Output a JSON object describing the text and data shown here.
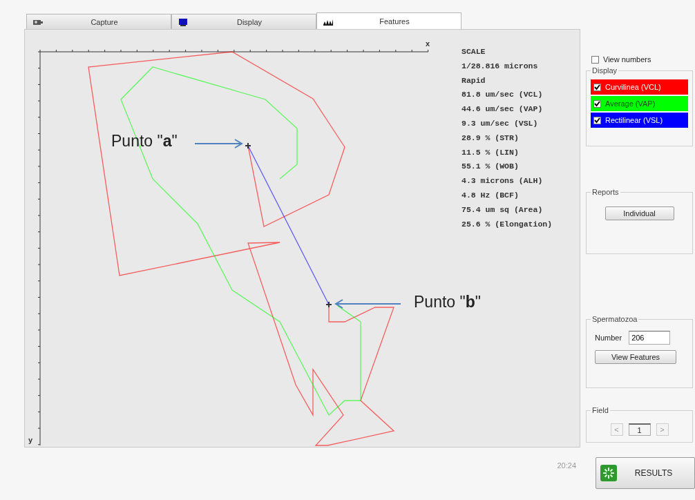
{
  "tabs": [
    {
      "label": "Capture",
      "kind": "camera",
      "selected": false
    },
    {
      "label": "Display",
      "kind": "monitor",
      "selected": false
    },
    {
      "label": "Features",
      "kind": "tracks",
      "selected": true
    }
  ],
  "plot": {
    "x_label": "x",
    "y_label": "y",
    "annotations": [
      {
        "text": "Punto \"**a**\""
      },
      {
        "text": "Punto \"**b**\""
      }
    ]
  },
  "stats": [
    "SCALE",
    "1/28.816 microns",
    "Rapid",
    "81.8 um/sec (VCL)",
    "44.6 um/sec (VAP)",
    "9.3 um/sec (VSL)",
    "28.9 % (STR)",
    "11.5 % (LIN)",
    "55.1 % (WOB)",
    "4.3 microns (ALH)",
    "4.8 Hz (BCF)",
    "75.4 um sq (Area)",
    "25.6 % (Elongation)"
  ],
  "view_numbers": {
    "label": "View numbers",
    "checked": false
  },
  "display": {
    "title": "Display",
    "tracks": [
      {
        "label": "Curvilinea (VCL)",
        "checked": true,
        "color": "#ff0000"
      },
      {
        "label": "Average (VAP)",
        "checked": true,
        "color": "#00ff00"
      },
      {
        "label": "Rectilinear (VSL)",
        "checked": true,
        "color": "#0000ff"
      }
    ]
  },
  "reports": {
    "title": "Reports",
    "button": "Individual"
  },
  "spermatozoa": {
    "title": "Spermatozoa",
    "number_label": "Number",
    "number_value": "206",
    "button": "View Features"
  },
  "field": {
    "title": "Field",
    "prev": "<",
    "value": "1",
    "next": ">"
  },
  "time": "20:24",
  "results_button": "RESULTS"
}
